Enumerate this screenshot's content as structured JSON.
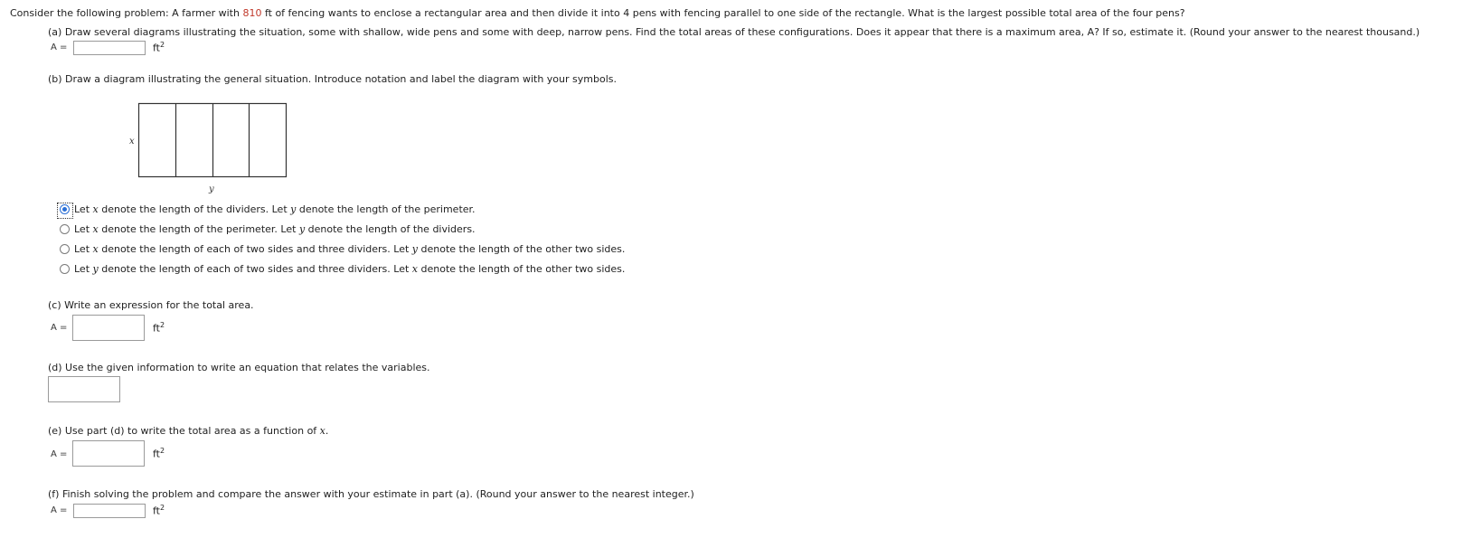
{
  "problem": {
    "intro_pre": "Consider the following problem: A farmer with ",
    "fence_length": "810",
    "intro_post": " ft of fencing wants to enclose a rectangular area and then divide it into 4 pens with fencing parallel to one side of the rectangle. What is the largest possible total area of the four pens?"
  },
  "part_a": {
    "text": "(a) Draw several diagrams illustrating the situation, some with shallow, wide pens and some with deep, narrow pens. Find the total areas of these configurations. Does it appear that there is a maximum area, A? If so, estimate it. (Round your answer to the nearest thousand.)",
    "label": "A =",
    "unit": "ft",
    "unit_exp": "2",
    "value": ""
  },
  "part_b": {
    "text": "(b) Draw a diagram illustrating the general situation. Introduce notation and label the diagram with your symbols.",
    "diagram_x_label": "x",
    "diagram_y_label": "y",
    "options": [
      {
        "text_parts": [
          "Let ",
          "x",
          " denote the length of the dividers. Let ",
          "y",
          " denote the length of the perimeter."
        ],
        "selected": true
      },
      {
        "text_parts": [
          "Let ",
          "x",
          " denote the length of the perimeter. Let ",
          "y",
          " denote the length of the dividers."
        ],
        "selected": false
      },
      {
        "text_parts": [
          "Let ",
          "x",
          " denote the length of each of two sides and three dividers. Let ",
          "y",
          " denote the length of the other two sides."
        ],
        "selected": false
      },
      {
        "text_parts": [
          "Let ",
          "y",
          " denote the length of each of two sides and three dividers. Let ",
          "x",
          " denote the length of the other two sides."
        ],
        "selected": false
      }
    ]
  },
  "part_c": {
    "text": "(c) Write an expression for the total area.",
    "label": "A =",
    "unit": "ft",
    "unit_exp": "2",
    "value": ""
  },
  "part_d": {
    "text": "(d) Use the given information to write an equation that relates the variables.",
    "value": ""
  },
  "part_e": {
    "text_pre": "(e) Use part (d) to write the total area as a function of ",
    "text_var": "x",
    "text_post": ".",
    "label": "A =",
    "unit": "ft",
    "unit_exp": "2",
    "value": ""
  },
  "part_f": {
    "text": "(f) Finish solving the problem and compare the answer with your estimate in part (a). (Round your answer to the nearest integer.)",
    "label": "A =",
    "unit": "ft",
    "unit_exp": "2",
    "value": ""
  },
  "colors": {
    "highlight": "#c0392b",
    "radio_selected": "#2a6fd6"
  }
}
